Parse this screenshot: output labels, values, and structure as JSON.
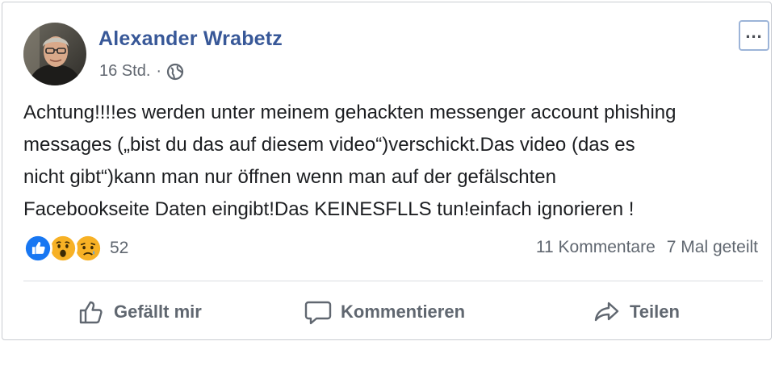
{
  "post": {
    "author": "Alexander Wrabetz",
    "time": "16 Std.",
    "separator": "·",
    "privacy_icon": "globe-icon",
    "lines": [
      "Achtung!!!!es werden unter meinem gehackten messenger account phishing",
      "messages („bist du das auf diesem video“)verschickt.Das video (das es",
      "nicht gibt“)kann man nur öffnen wenn man auf der gefälschten",
      "Facebookseite Daten eingibt!Das KEINESFLLS tun!einfach ignorieren !"
    ]
  },
  "reactions": {
    "icons": [
      "like-reaction-icon",
      "wow-reaction-icon",
      "sad-reaction-icon"
    ],
    "count": "52"
  },
  "stats": {
    "comments": "11 Kommentare",
    "shares": "7 Mal geteilt"
  },
  "actions": {
    "like": "Gefällt mir",
    "comment": "Kommentieren",
    "share": "Teilen"
  },
  "colors": {
    "name": "#385898",
    "like_blue": "#1877f2",
    "emoji_yellow": "#f7b125"
  }
}
